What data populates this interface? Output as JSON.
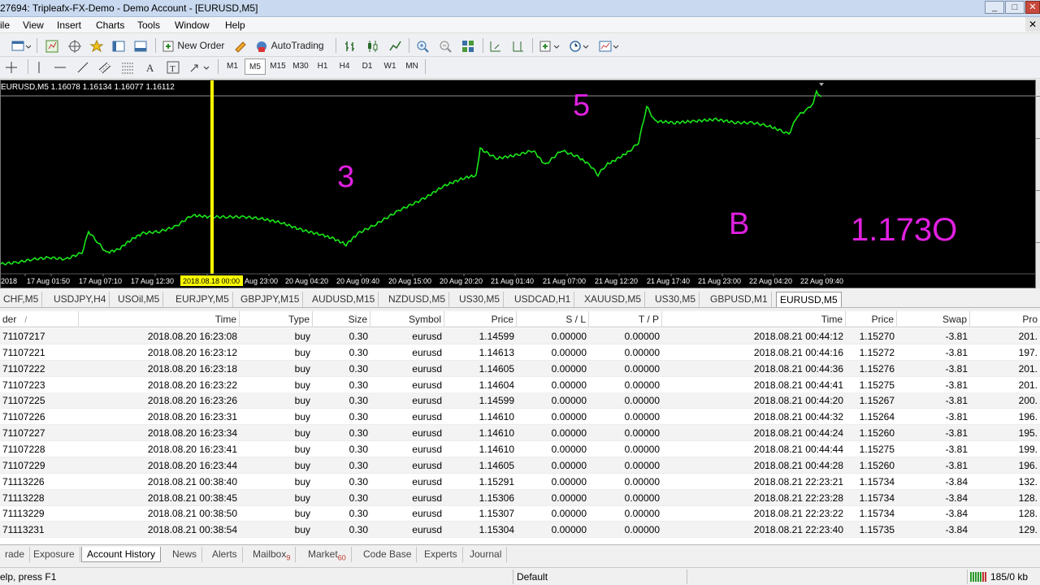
{
  "window": {
    "title": "27694: Tripleafx-FX-Demo - Demo Account - [EURUSD,M5]",
    "controls": [
      "_",
      "□",
      "✕"
    ]
  },
  "menu": [
    "ile",
    "View",
    "Insert",
    "Charts",
    "Tools",
    "Window",
    "Help"
  ],
  "toolbar": {
    "new_order": "New Order",
    "auto_trading": "AutoTrading",
    "timeframes": [
      "M1",
      "M5",
      "M15",
      "M30",
      "H1",
      "H4",
      "D1",
      "W1",
      "MN"
    ],
    "selected_timeframe": "M5"
  },
  "chart": {
    "info": "EURUSD,M5  1.16078 1.16134 1.16077 1.16112",
    "annotations": {
      "a": "3",
      "b": "5",
      "c": "B",
      "d": "1.173O"
    },
    "time_labels": [
      "2018",
      "17 Aug 01:50",
      "17 Aug 07:10",
      "17 Aug 12:30",
      "2018.08.18 00:00",
      "Aug 23:00",
      "20 Aug 04:20",
      "20 Aug 09:40",
      "20 Aug 15:00",
      "20 Aug 20:20",
      "21 Aug 01:40",
      "21 Aug 07:00",
      "21 Aug 12:20",
      "21 Aug 17:40",
      "21 Aug 23:00",
      "22 Aug 04:20",
      "22 Aug 09:40"
    ],
    "line_color": "#19e619",
    "annotation_color": "#e020e0",
    "vline_color": "#ffff00"
  },
  "symbol_tabs": [
    "CHF,M5",
    "USDJPY,H4",
    "USOil,M5",
    "EURJPY,M5",
    "GBPJPY,M15",
    "AUDUSD,M15",
    "NZDUSD,M5",
    "US30,M5",
    "USDCAD,H1",
    "XAUUSD,M5",
    "US30,M5",
    "GBPUSD,M1",
    "EURUSD,M5"
  ],
  "active_symbol_tab": "EURUSD,M5",
  "table": {
    "headers": {
      "order": "der",
      "time": "Time",
      "type": "Type",
      "size": "Size",
      "symbol": "Symbol",
      "price": "Price",
      "sl": "S / L",
      "tp": "T / P",
      "time2": "Time",
      "price2": "Price",
      "swap": "Swap",
      "profit": "Pro"
    },
    "rows": [
      [
        "71107217",
        "2018.08.20 16:23:08",
        "buy",
        "0.30",
        "eurusd",
        "1.14599",
        "0.00000",
        "0.00000",
        "2018.08.21 00:44:12",
        "1.15270",
        "-3.81",
        "201."
      ],
      [
        "71107221",
        "2018.08.20 16:23:12",
        "buy",
        "0.30",
        "eurusd",
        "1.14613",
        "0.00000",
        "0.00000",
        "2018.08.21 00:44:16",
        "1.15272",
        "-3.81",
        "197."
      ],
      [
        "71107222",
        "2018.08.20 16:23:18",
        "buy",
        "0.30",
        "eurusd",
        "1.14605",
        "0.00000",
        "0.00000",
        "2018.08.21 00:44:36",
        "1.15276",
        "-3.81",
        "201."
      ],
      [
        "71107223",
        "2018.08.20 16:23:22",
        "buy",
        "0.30",
        "eurusd",
        "1.14604",
        "0.00000",
        "0.00000",
        "2018.08.21 00:44:41",
        "1.15275",
        "-3.81",
        "201."
      ],
      [
        "71107225",
        "2018.08.20 16:23:26",
        "buy",
        "0.30",
        "eurusd",
        "1.14599",
        "0.00000",
        "0.00000",
        "2018.08.21 00:44:20",
        "1.15267",
        "-3.81",
        "200."
      ],
      [
        "71107226",
        "2018.08.20 16:23:31",
        "buy",
        "0.30",
        "eurusd",
        "1.14610",
        "0.00000",
        "0.00000",
        "2018.08.21 00:44:32",
        "1.15264",
        "-3.81",
        "196."
      ],
      [
        "71107227",
        "2018.08.20 16:23:34",
        "buy",
        "0.30",
        "eurusd",
        "1.14610",
        "0.00000",
        "0.00000",
        "2018.08.21 00:44:24",
        "1.15260",
        "-3.81",
        "195."
      ],
      [
        "71107228",
        "2018.08.20 16:23:41",
        "buy",
        "0.30",
        "eurusd",
        "1.14610",
        "0.00000",
        "0.00000",
        "2018.08.21 00:44:44",
        "1.15275",
        "-3.81",
        "199."
      ],
      [
        "71107229",
        "2018.08.20 16:23:44",
        "buy",
        "0.30",
        "eurusd",
        "1.14605",
        "0.00000",
        "0.00000",
        "2018.08.21 00:44:28",
        "1.15260",
        "-3.81",
        "196."
      ],
      [
        "71113226",
        "2018.08.21 00:38:40",
        "buy",
        "0.30",
        "eurusd",
        "1.15291",
        "0.00000",
        "0.00000",
        "2018.08.21 22:23:21",
        "1.15734",
        "-3.84",
        "132."
      ],
      [
        "71113228",
        "2018.08.21 00:38:45",
        "buy",
        "0.30",
        "eurusd",
        "1.15306",
        "0.00000",
        "0.00000",
        "2018.08.21 22:23:28",
        "1.15734",
        "-3.84",
        "128."
      ],
      [
        "71113229",
        "2018.08.21 00:38:50",
        "buy",
        "0.30",
        "eurusd",
        "1.15307",
        "0.00000",
        "0.00000",
        "2018.08.21 22:23:22",
        "1.15734",
        "-3.84",
        "128."
      ],
      [
        "71113231",
        "2018.08.21 00:38:54",
        "buy",
        "0.30",
        "eurusd",
        "1.15304",
        "0.00000",
        "0.00000",
        "2018.08.21 22:23:40",
        "1.15735",
        "-3.84",
        "129."
      ]
    ]
  },
  "bottom_tabs": [
    {
      "label": "rade",
      "badge": ""
    },
    {
      "label": "Exposure",
      "badge": ""
    },
    {
      "label": "Account History",
      "badge": ""
    },
    {
      "label": "News",
      "badge": ""
    },
    {
      "label": "Alerts",
      "badge": ""
    },
    {
      "label": "Mailbox",
      "badge": "9"
    },
    {
      "label": "Market",
      "badge": "60"
    },
    {
      "label": "Code Base",
      "badge": ""
    },
    {
      "label": "Experts",
      "badge": ""
    },
    {
      "label": "Journal",
      "badge": ""
    }
  ],
  "active_bottom_tab": "Account History",
  "status": {
    "help": "elp, press F1",
    "profile": "Default",
    "traffic": "185/0 kb"
  }
}
